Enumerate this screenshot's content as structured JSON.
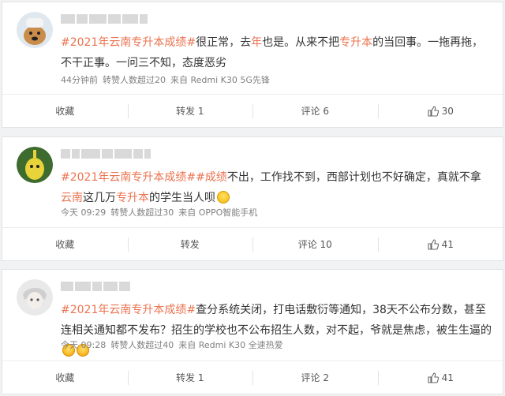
{
  "posts": [
    {
      "text": [
        {
          "t": "#2021年云南专升本成绩#",
          "c": "topic"
        },
        {
          "t": "很正常，去",
          "c": ""
        },
        {
          "t": "年",
          "c": "kw"
        },
        {
          "t": "也是。从来不把",
          "c": ""
        },
        {
          "t": "专升本",
          "c": "kw"
        },
        {
          "t": "的当回事。一拖再拖，不干正事。一问三不知，态度恶劣",
          "c": ""
        }
      ],
      "time": "44分钟前",
      "reposts": "转赞人数超过20",
      "source": "来自 Redmi K30 5G先锋",
      "actions": {
        "collect": "收藏",
        "repost": "转发 1",
        "comment": "评论 6",
        "like": "30"
      }
    },
    {
      "text": [
        {
          "t": "#2021年云南专升本成绩#",
          "c": "topic"
        },
        {
          "t": "#成绩",
          "c": "kw"
        },
        {
          "t": "不出，工作找不到，西部计划也不好确定，真就不拿",
          "c": ""
        },
        {
          "t": "云南",
          "c": "kw"
        },
        {
          "t": "这几万",
          "c": ""
        },
        {
          "t": "专升本",
          "c": "kw"
        },
        {
          "t": "的学生当人呗",
          "c": ""
        }
      ],
      "emojis": [
        "smile"
      ],
      "time": "今天 09:29",
      "reposts": "转赞人数超过30",
      "source": "来自 OPPO智能手机",
      "actions": {
        "collect": "收藏",
        "repost": "转发",
        "comment": "评论 10",
        "like": "41"
      }
    },
    {
      "text": [
        {
          "t": "#2021年云南专升本成绩#",
          "c": "topic"
        },
        {
          "t": "查分系统关闭，打电话敷衍等通知，38天不公布分数，甚至连相关通知都不发布？招生的学校也不公布招生人数，对不起，爷就是焦虑，被生生逼的",
          "c": ""
        }
      ],
      "emojis": [
        "shock",
        "shock"
      ],
      "time": "今天 09:28",
      "reposts": "转赞人数超过40",
      "source": "来自 Redmi K30 全速热爱",
      "actions": {
        "collect": "收藏",
        "repost": "转发 1",
        "comment": "评论 2",
        "like": "41"
      }
    }
  ],
  "colors": {
    "topic": "#eb7350",
    "bg": "#f1f2f4"
  },
  "icons": {
    "like": "thumbs-up-icon"
  }
}
